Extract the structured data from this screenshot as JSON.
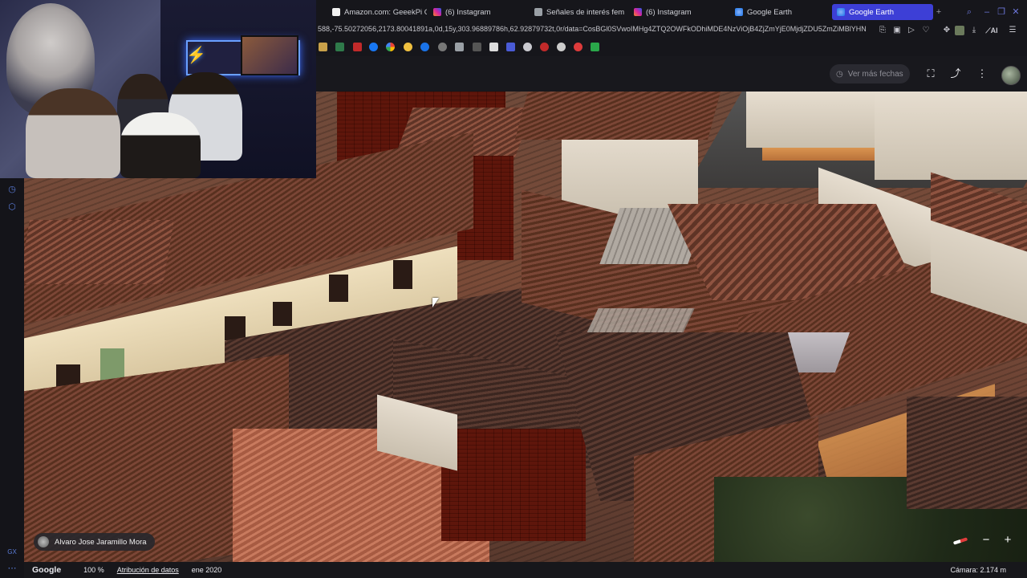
{
  "tabs": [
    {
      "label": "Amazon.com: GeeekPi Or",
      "favicon": "amazon-icon",
      "color": "#f1f1f1"
    },
    {
      "label": "(6) Instagram",
      "favicon": "instagram-icon",
      "color": "#d6249f"
    },
    {
      "label": "Señales de interés feme",
      "favicon": "document-icon",
      "color": "#9aa0a6"
    },
    {
      "label": "(6) Instagram",
      "favicon": "instagram-icon",
      "color": "#d6249f"
    },
    {
      "label": "Google Earth",
      "favicon": "google-earth-icon",
      "color": "#4285f4"
    },
    {
      "label": "Google Earth",
      "favicon": "google-earth-icon",
      "color": "#4285f4",
      "active": true
    }
  ],
  "address_bar": {
    "url": "588,-75.50272056,2173.80041891a,0d,15y,303.96889786h,62.92879732t,0r/data=CosBGl0SVwoIMHg4ZTQ2OWFkODhiMDE4NzViOjB4ZjZmYjE0MjdjZDU5ZmZiMBlYHN"
  },
  "earth_header": {
    "ver_mas_label": "Ver más fechas"
  },
  "author_chip": {
    "name": "Alvaro Jose Jaramillo Mora"
  },
  "footer": {
    "brand": "Google",
    "zoom": "100 %",
    "attribution_link": "Atribución de datos",
    "date": "ene 2020",
    "camera": "Cámara: 2.174 m"
  },
  "colors": {
    "accent": "#3d3fd6",
    "tab_bg": "#16161b",
    "gx_accent": "#6c76d9"
  }
}
